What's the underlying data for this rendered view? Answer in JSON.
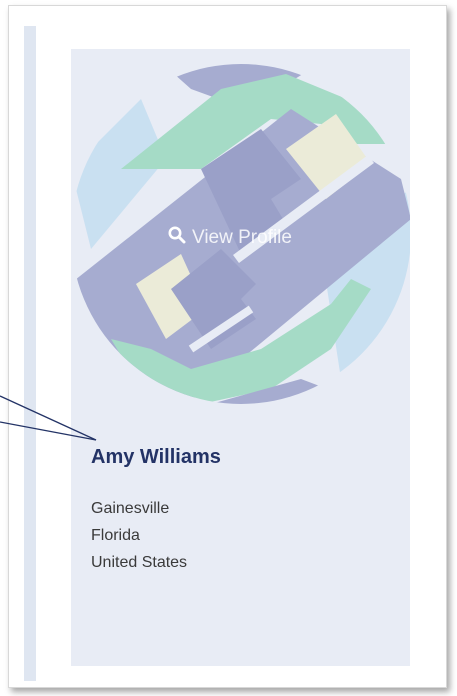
{
  "profile_card": {
    "view_profile_label": "View Profile",
    "name": "Amy Williams",
    "location": {
      "city": "Gainesville",
      "state": "Florida",
      "country": "United States"
    }
  },
  "colors": {
    "name_text": "#233366",
    "card_background": "#e8ecf5",
    "logo_purple": "#a6acd0",
    "logo_green": "#a5dbc6",
    "logo_blue": "#c9e0f1",
    "logo_cream": "#ebebd8",
    "callout_line": "#233366"
  },
  "icons": {
    "search": "search-icon",
    "logo": "globe-arrows-logo"
  }
}
